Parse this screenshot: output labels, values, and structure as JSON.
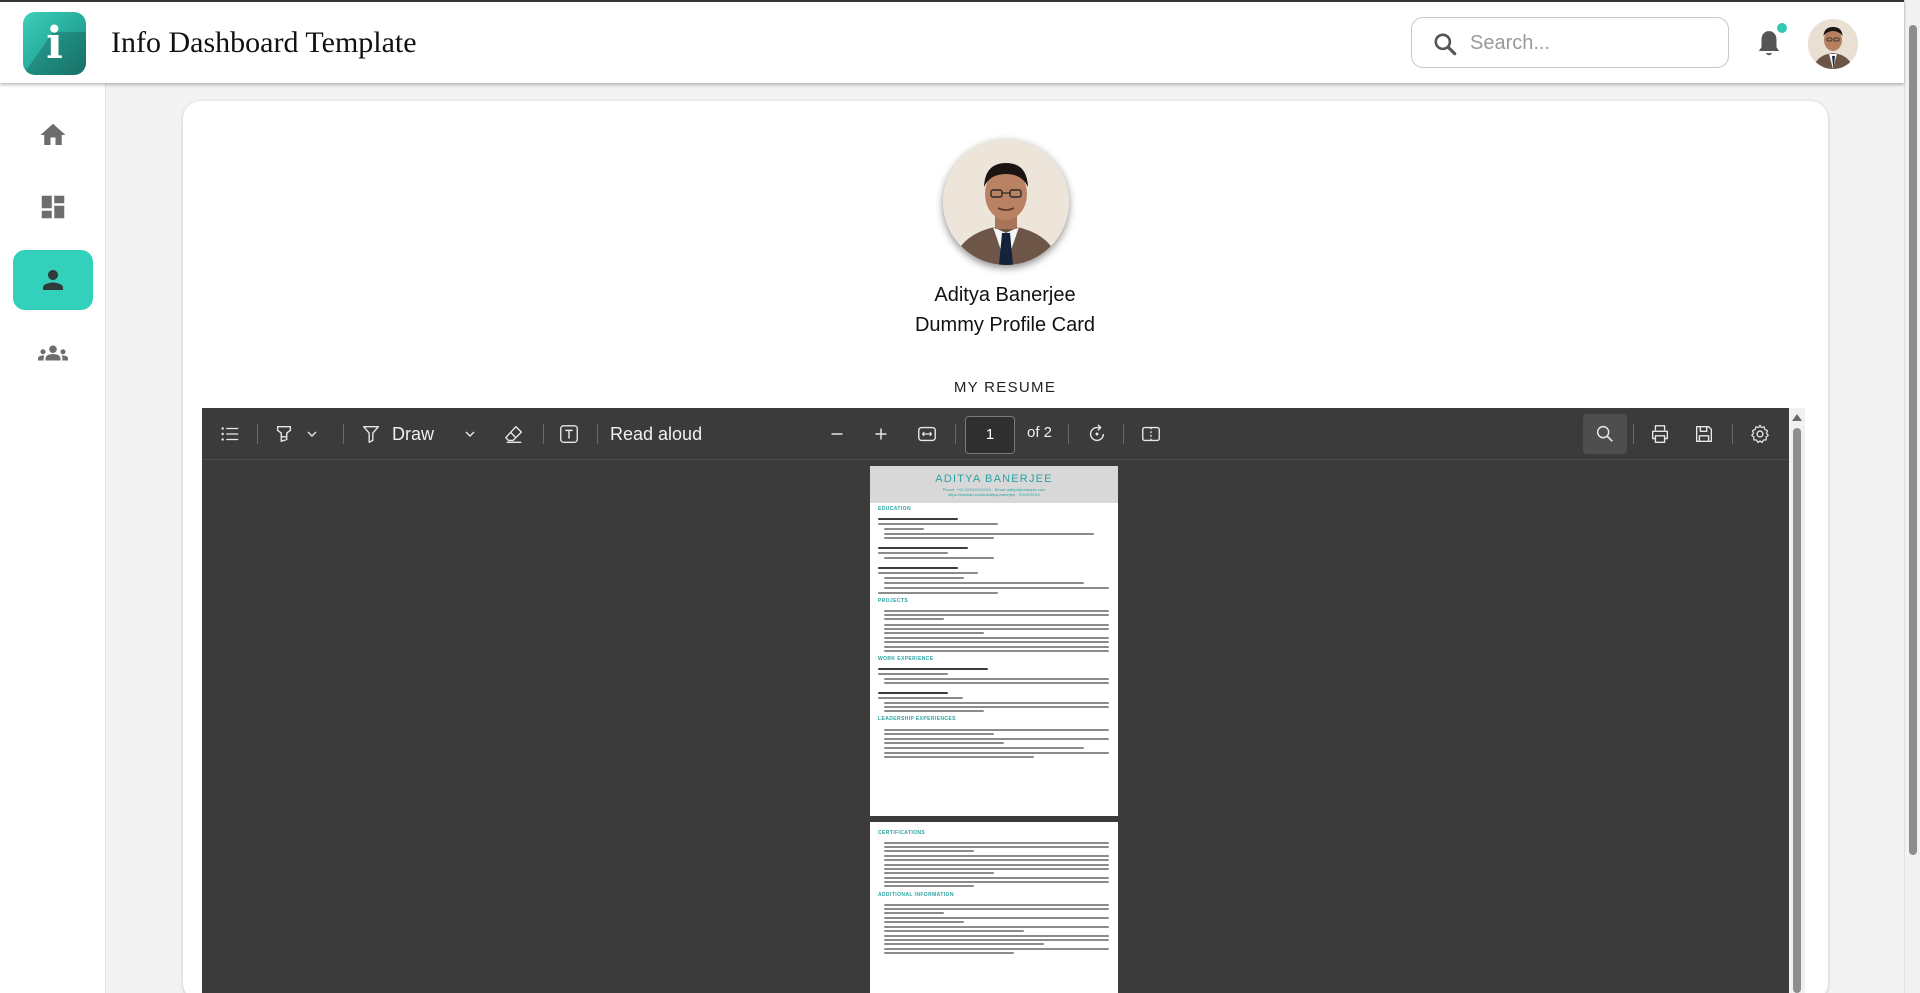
{
  "header": {
    "app_title": "Info Dashboard Template",
    "logo_letter": "i",
    "search_placeholder": "Search...",
    "accent_color": "#33d1bb"
  },
  "sidebar": {
    "items": [
      {
        "icon": "home-icon",
        "active": false
      },
      {
        "icon": "dashboard-icon",
        "active": false
      },
      {
        "icon": "person-icon",
        "active": true
      },
      {
        "icon": "group-icon",
        "active": false
      }
    ]
  },
  "profile": {
    "name": "Aditya Banerjee",
    "subtitle": "Dummy Profile Card",
    "resume_heading": "MY RESUME"
  },
  "pdf_toolbar": {
    "draw_label": "Draw",
    "read_aloud_label": "Read aloud",
    "current_page": "1",
    "of_pages": "of 2"
  },
  "resume": {
    "name": "ADITYA BANERJEE",
    "contact_line1": "Phone: +91 XXXXXXXXXX · Email: aditya@example.com",
    "contact_line2": "https://linkedin.com/in/aditya-banerjee · XXXXXXXX",
    "sections_page1": [
      "EDUCATION",
      "PROJECTS",
      "WORK EXPERIENCE",
      "LEADERSHIP EXPERIENCES"
    ],
    "sections_page2": [
      "CERTIFICATIONS",
      "ADDITIONAL INFORMATION"
    ]
  }
}
